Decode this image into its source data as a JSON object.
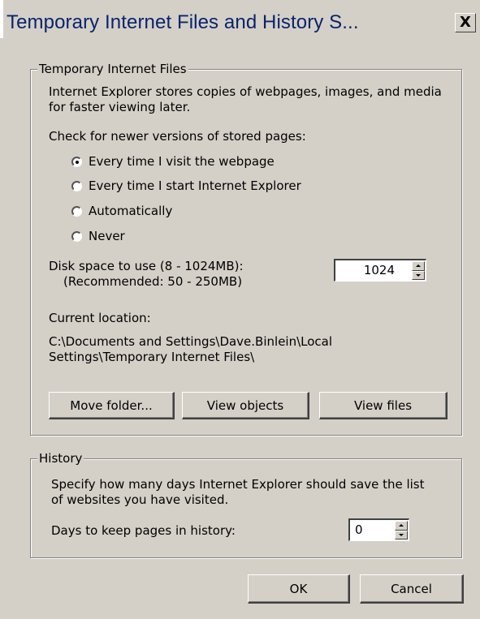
{
  "window": {
    "title": "Temporary Internet Files and History S...",
    "close_label": "X"
  },
  "temp_files": {
    "legend": "Temporary Internet Files",
    "description_line1": "Internet Explorer stores copies of webpages, images, and media",
    "description_line2": "for faster viewing later.",
    "check_label": "Check for newer versions of stored pages:",
    "options": [
      {
        "label": "Every time I visit the webpage",
        "checked": true
      },
      {
        "label": "Every time I start Internet Explorer",
        "checked": false
      },
      {
        "label": "Automatically",
        "checked": false
      },
      {
        "label": "Never",
        "checked": false
      }
    ],
    "disk_label": "Disk space to use (8 - 1024MB):",
    "disk_recommended": "(Recommended: 50 - 250MB)",
    "disk_value": "1024",
    "location_label": "Current location:",
    "location_line1": "C:\\Documents and Settings\\Dave.Binlein\\Local",
    "location_line2": "Settings\\Temporary Internet Files\\",
    "move_folder_label": "Move folder...",
    "view_objects_label": "View objects",
    "view_files_label": "View files"
  },
  "history": {
    "legend": "History",
    "description_line1": "Specify how many days Internet Explorer should save the list",
    "description_line2": "of websites you have visited.",
    "days_label": "Days to keep pages in history:",
    "days_value": "0"
  },
  "footer": {
    "ok_label": "OK",
    "cancel_label": "Cancel"
  }
}
